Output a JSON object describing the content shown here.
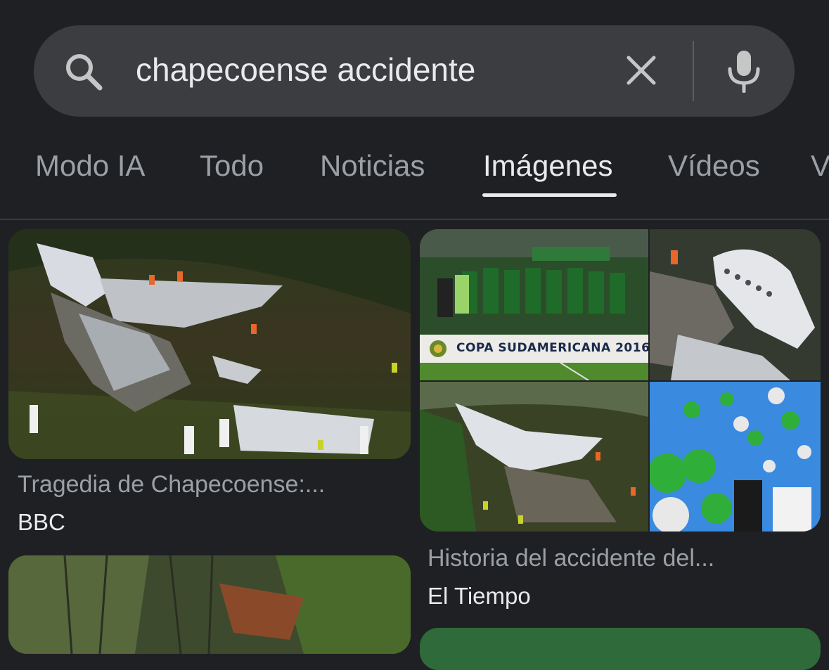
{
  "search": {
    "query": "chapecoense accidente",
    "search_icon": "search-icon",
    "clear_icon": "close-icon",
    "mic_icon": "microphone-icon"
  },
  "tabs": [
    {
      "label": "Modo IA",
      "active": false
    },
    {
      "label": "Todo",
      "active": false
    },
    {
      "label": "Noticias",
      "active": false
    },
    {
      "label": "Imágenes",
      "active": true
    },
    {
      "label": "Vídeos",
      "active": false
    },
    {
      "label": "V",
      "active": false
    }
  ],
  "results": [
    {
      "title": "Tragedia de Chapecoense:...",
      "source": "BBC"
    },
    {
      "title": "Historia del accidente del...",
      "source": "El Tiempo",
      "banner_text": "COPA SUDAMERICANA 2016"
    }
  ],
  "colors": {
    "background": "#1f2023",
    "search_bar": "#3c3d41",
    "text_primary": "#e8eaed",
    "text_secondary": "#9aa0a6"
  }
}
